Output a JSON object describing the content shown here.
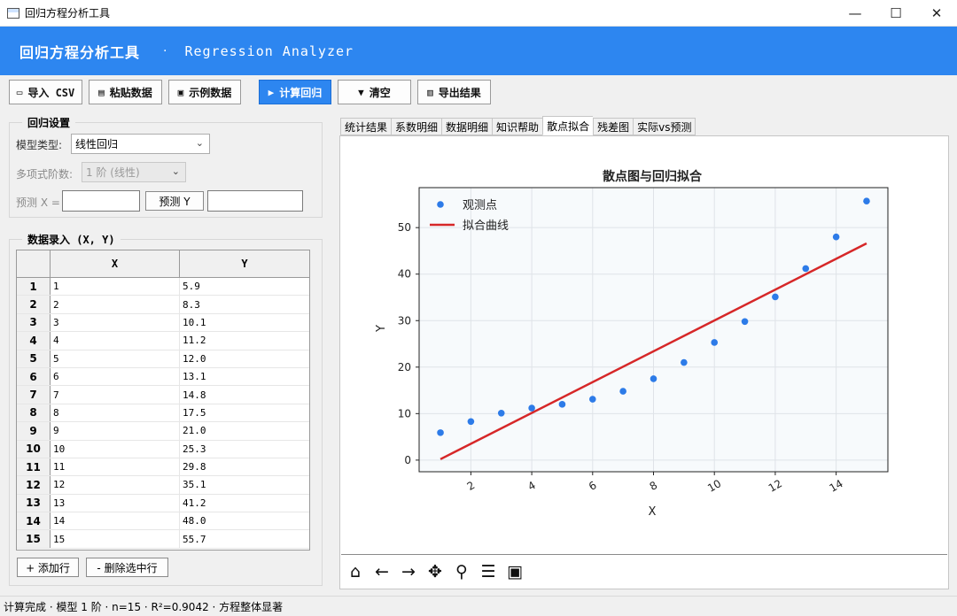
{
  "window": {
    "title": "回归方程分析工具",
    "min_glyph": "—",
    "max_glyph": "☐",
    "close_glyph": "✕"
  },
  "banner": {
    "title": "回归方程分析工具",
    "separator": "·",
    "subtitle": "Regression Analyzer"
  },
  "toolbar": {
    "import_csv": "导入 CSV",
    "paste_data": "粘贴数据",
    "example_data": "示例数据",
    "compute": "计算回归",
    "clear": "清空",
    "export": "导出结果"
  },
  "settings": {
    "title": "回归设置",
    "model_label": "模型类型:",
    "model_value": "线性回归",
    "degree_label": "多项式阶数:",
    "degree_value": "1 阶 (线性)",
    "predict_label": "预测 X =",
    "predict_button": "预测 Y"
  },
  "data_entry": {
    "title": "数据录入 (X, Y)",
    "columns": [
      "X",
      "Y"
    ],
    "rows": [
      {
        "idx": "1",
        "x": "1",
        "y": "5.9"
      },
      {
        "idx": "2",
        "x": "2",
        "y": "8.3"
      },
      {
        "idx": "3",
        "x": "3",
        "y": "10.1"
      },
      {
        "idx": "4",
        "x": "4",
        "y": "11.2"
      },
      {
        "idx": "5",
        "x": "5",
        "y": "12.0"
      },
      {
        "idx": "6",
        "x": "6",
        "y": "13.1"
      },
      {
        "idx": "7",
        "x": "7",
        "y": "14.8"
      },
      {
        "idx": "8",
        "x": "8",
        "y": "17.5"
      },
      {
        "idx": "9",
        "x": "9",
        "y": "21.0"
      },
      {
        "idx": "10",
        "x": "10",
        "y": "25.3"
      },
      {
        "idx": "11",
        "x": "11",
        "y": "29.8"
      },
      {
        "idx": "12",
        "x": "12",
        "y": "35.1"
      },
      {
        "idx": "13",
        "x": "13",
        "y": "41.2"
      },
      {
        "idx": "14",
        "x": "14",
        "y": "48.0"
      },
      {
        "idx": "15",
        "x": "15",
        "y": "55.7"
      }
    ],
    "add_row": "+ 添加行",
    "delete_row": "- 删除选中行"
  },
  "tabs": [
    "统计结果",
    "系数明细",
    "数据明细",
    "知识帮助",
    "散点拟合",
    "残差图",
    "实际vs预测"
  ],
  "active_tab": 4,
  "status": "计算完成 · 模型 1 阶 · n=15 · R²=0.9042 · 方程整体显著",
  "chart_data": {
    "type": "scatter",
    "title": "散点图与回归拟合",
    "xlabel": "X",
    "ylabel": "Y",
    "xlim": [
      0.3,
      15.7
    ],
    "ylim": [
      -2.5,
      58.6
    ],
    "xticks": [
      2,
      4,
      6,
      8,
      10,
      12,
      14
    ],
    "yticks": [
      0,
      10,
      20,
      30,
      40,
      50
    ],
    "grid": true,
    "legend": "top-left",
    "series": [
      {
        "name": "观测点",
        "kind": "scatter",
        "color": "#2d7be8",
        "x": [
          1,
          2,
          3,
          4,
          5,
          6,
          7,
          8,
          9,
          10,
          11,
          12,
          13,
          14,
          15
        ],
        "y": [
          5.9,
          8.3,
          10.1,
          11.2,
          12.0,
          13.1,
          14.8,
          17.5,
          21.0,
          25.3,
          29.8,
          35.1,
          41.2,
          48.0,
          55.7
        ]
      },
      {
        "name": "拟合曲线",
        "kind": "line",
        "color": "#d62728",
        "x": [
          1,
          15
        ],
        "y": [
          0.2,
          46.6
        ]
      }
    ]
  },
  "colors": {
    "accent": "#2d86f0",
    "plot_bg": "#f7fafc"
  }
}
